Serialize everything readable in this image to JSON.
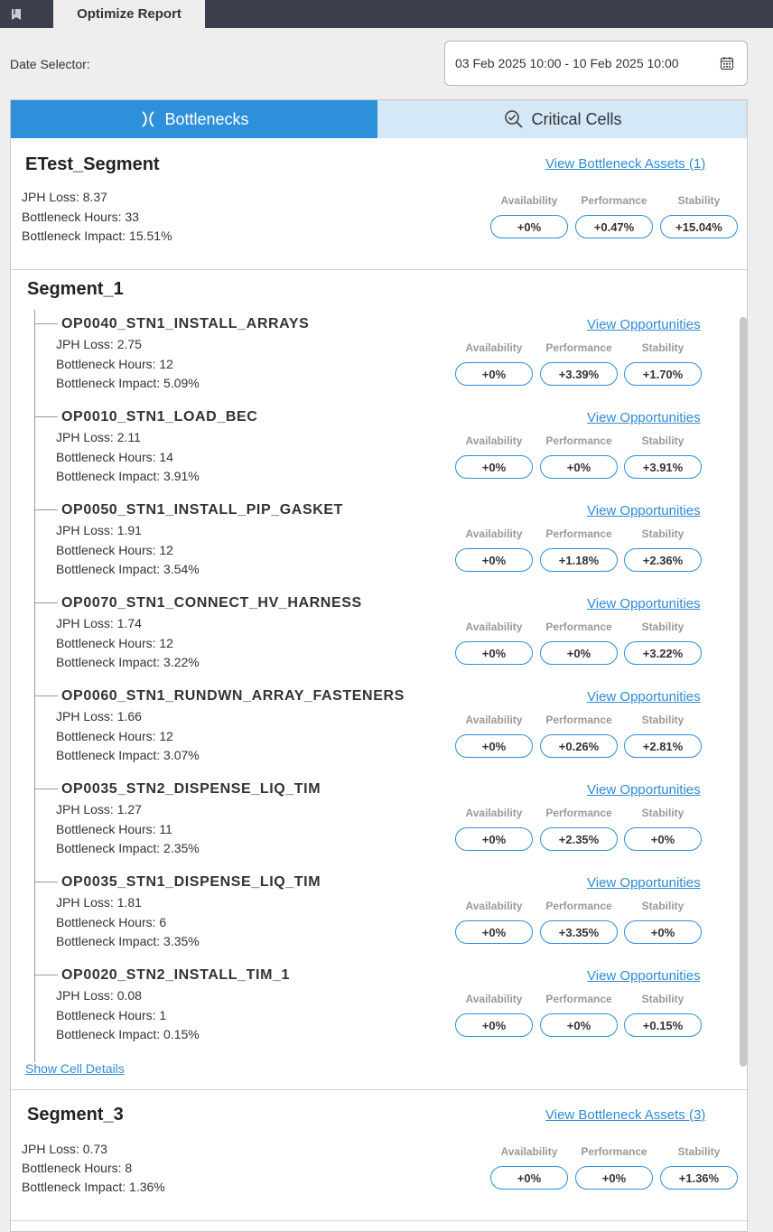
{
  "app": {
    "tab_label": "Optimize Report",
    "date_label": "Date Selector:",
    "date_range": "03 Feb 2025 10:00 - 10 Feb 2025 10:00"
  },
  "tabs": {
    "bottlenecks": "Bottlenecks",
    "critical_cells": "Critical Cells"
  },
  "metric_labels": {
    "availability": "Availability",
    "performance": "Performance",
    "stability": "Stability"
  },
  "segments": [
    {
      "name": "ETest_Segment",
      "link": "View Bottleneck Assets (1)",
      "jph": "JPH Loss: 8.37",
      "hours": "Bottleneck Hours: 33",
      "impact": "Bottleneck Impact: 15.51%",
      "availability": "+0%",
      "performance": "+0.47%",
      "stability": "+15.04%"
    },
    {
      "name": "Segment_1",
      "show_details": "Show Cell Details",
      "ops": [
        {
          "name": "OP0040_STN1_INSTALL_ARRAYS",
          "link": "View Opportunities",
          "jph": "JPH Loss: 2.75",
          "hours": "Bottleneck Hours: 12",
          "impact": "Bottleneck Impact: 5.09%",
          "availability": "+0%",
          "performance": "+3.39%",
          "stability": "+1.70%"
        },
        {
          "name": "OP0010_STN1_LOAD_BEC",
          "link": "View Opportunities",
          "jph": "JPH Loss: 2.11",
          "hours": "Bottleneck Hours: 14",
          "impact": "Bottleneck Impact: 3.91%",
          "availability": "+0%",
          "performance": "+0%",
          "stability": "+3.91%"
        },
        {
          "name": "OP0050_STN1_INSTALL_PIP_GASKET",
          "link": "View Opportunities",
          "jph": "JPH Loss: 1.91",
          "hours": "Bottleneck Hours: 12",
          "impact": "Bottleneck Impact: 3.54%",
          "availability": "+0%",
          "performance": "+1.18%",
          "stability": "+2.36%"
        },
        {
          "name": "OP0070_STN1_CONNECT_HV_HARNESS",
          "link": "View Opportunities",
          "jph": "JPH Loss: 1.74",
          "hours": "Bottleneck Hours: 12",
          "impact": "Bottleneck Impact: 3.22%",
          "availability": "+0%",
          "performance": "+0%",
          "stability": "+3.22%"
        },
        {
          "name": "OP0060_STN1_RUNDWN_ARRAY_FASTENERS",
          "link": "View Opportunities",
          "jph": "JPH Loss: 1.66",
          "hours": "Bottleneck Hours: 12",
          "impact": "Bottleneck Impact: 3.07%",
          "availability": "+0%",
          "performance": "+0.26%",
          "stability": "+2.81%"
        },
        {
          "name": "OP0035_STN2_DISPENSE_LIQ_TIM",
          "link": "View Opportunities",
          "jph": "JPH Loss: 1.27",
          "hours": "Bottleneck Hours: 11",
          "impact": "Bottleneck Impact: 2.35%",
          "availability": "+0%",
          "performance": "+2.35%",
          "stability": "+0%"
        },
        {
          "name": "OP0035_STN1_DISPENSE_LIQ_TIM",
          "link": "View Opportunities",
          "jph": "JPH Loss: 1.81",
          "hours": "Bottleneck Hours: 6",
          "impact": "Bottleneck Impact: 3.35%",
          "availability": "+0%",
          "performance": "+3.35%",
          "stability": "+0%"
        },
        {
          "name": "OP0020_STN2_INSTALL_TIM_1",
          "link": "View Opportunities",
          "jph": "JPH Loss: 0.08",
          "hours": "Bottleneck Hours: 1",
          "impact": "Bottleneck Impact: 0.15%",
          "availability": "+0%",
          "performance": "+0%",
          "stability": "+0.15%"
        }
      ]
    },
    {
      "name": "Segment_3",
      "link": "View Bottleneck Assets (3)",
      "jph": "JPH Loss: 0.73",
      "hours": "Bottleneck Hours: 8",
      "impact": "Bottleneck Impact: 1.36%",
      "availability": "+0%",
      "performance": "+0%",
      "stability": "+1.36%"
    }
  ]
}
